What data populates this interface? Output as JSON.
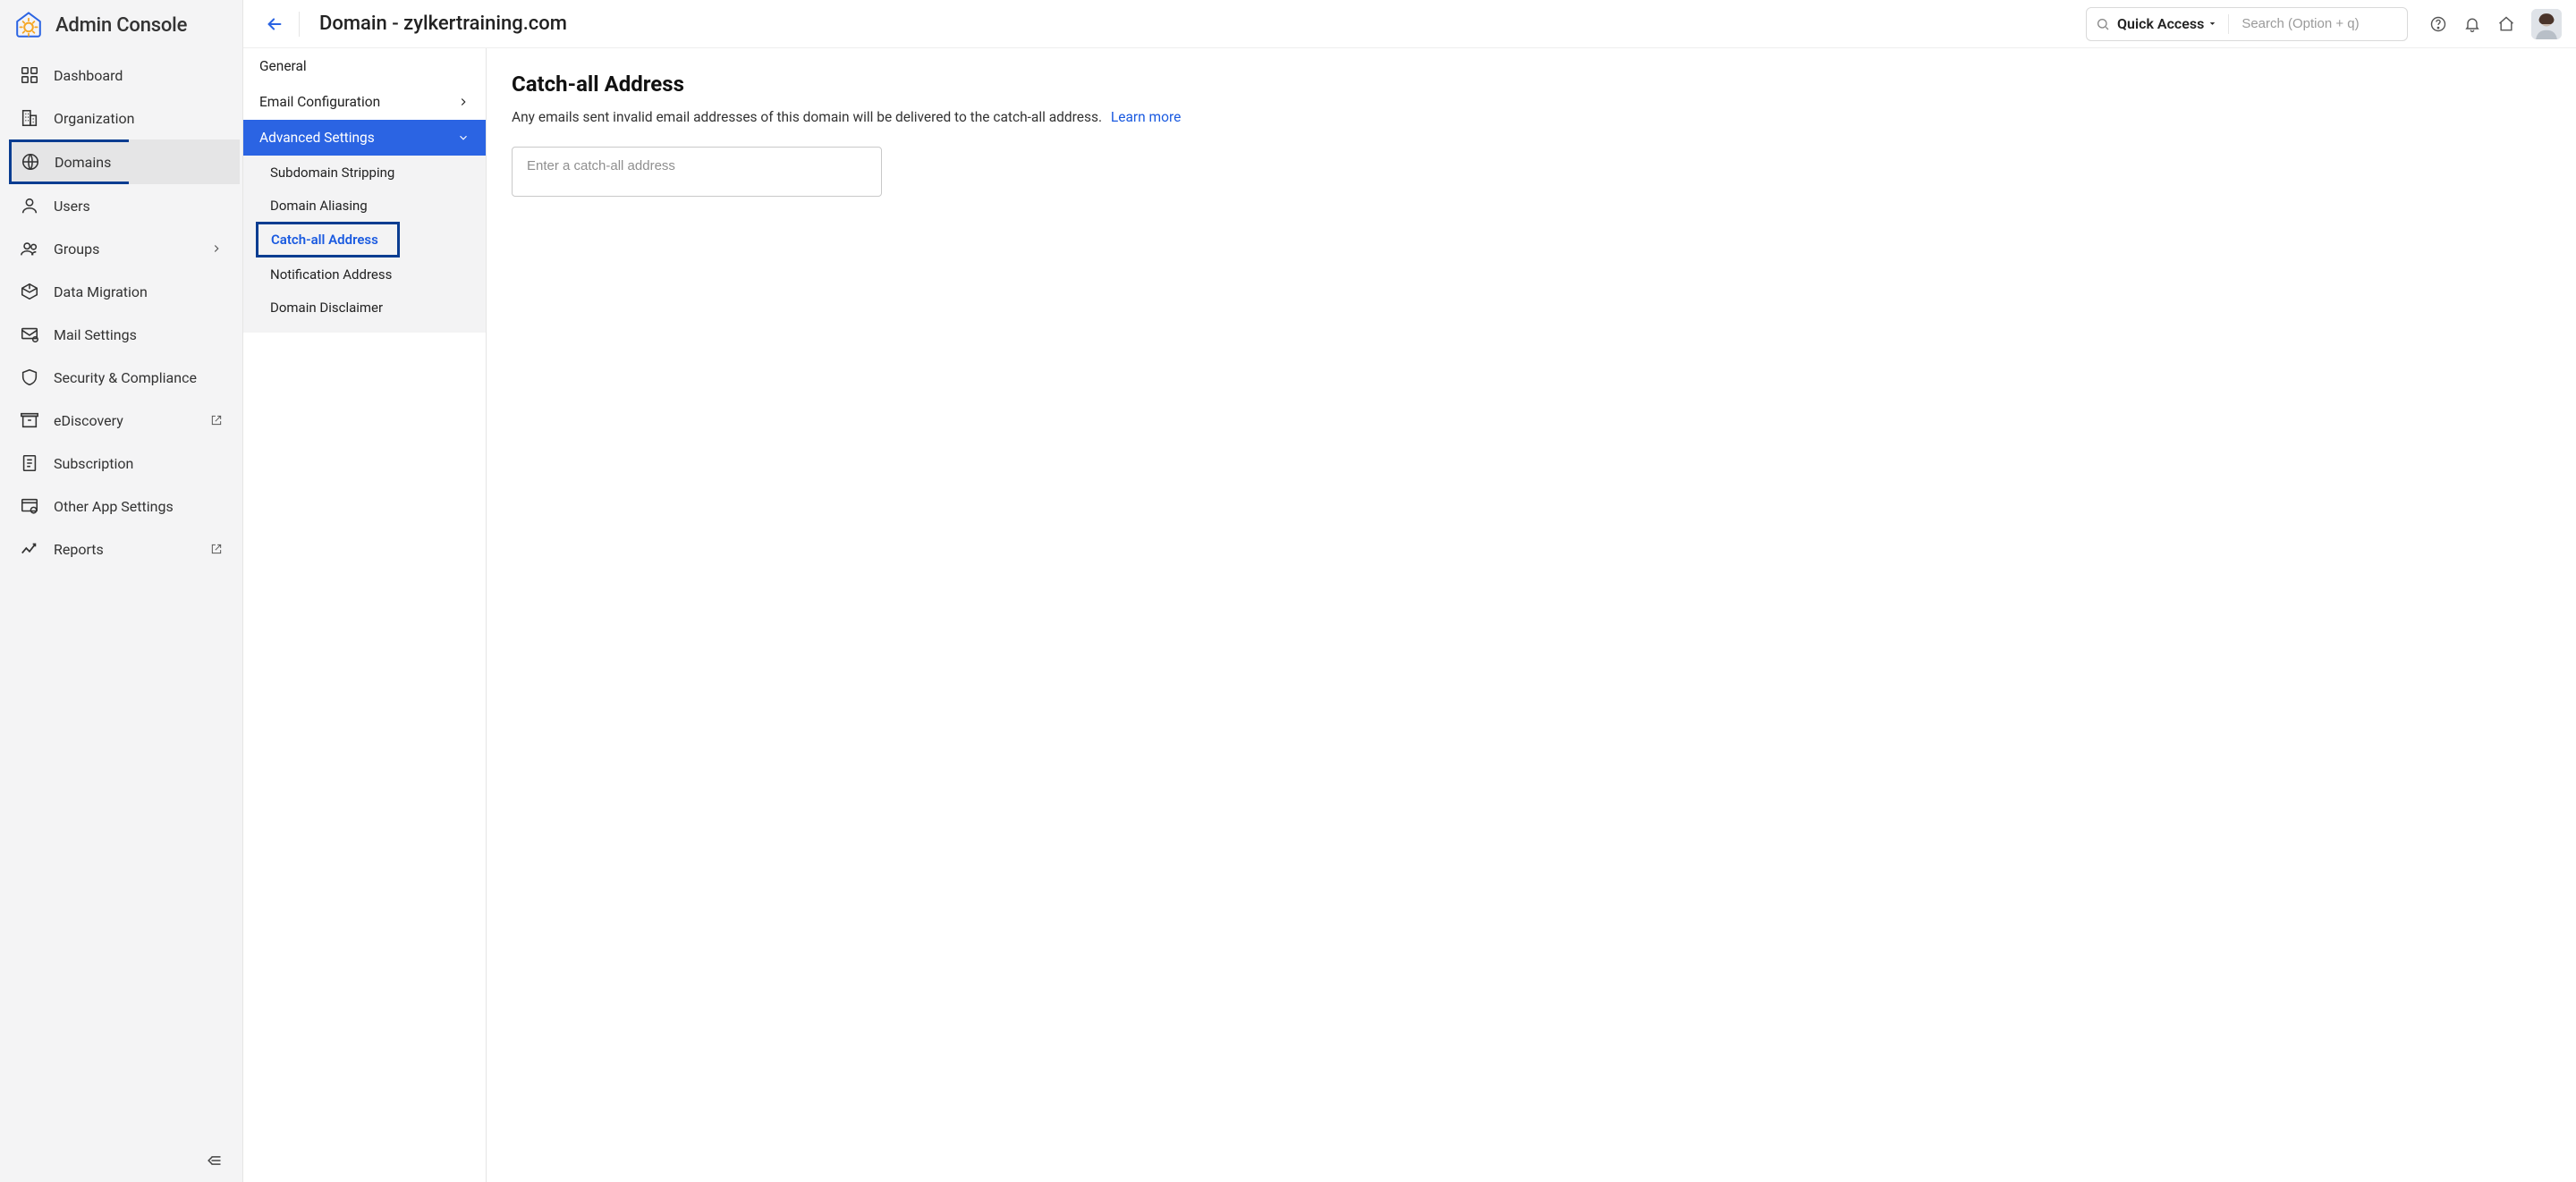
{
  "app": {
    "title": "Admin Console"
  },
  "sidebar": {
    "items": [
      {
        "label": "Dashboard"
      },
      {
        "label": "Organization"
      },
      {
        "label": "Domains"
      },
      {
        "label": "Users"
      },
      {
        "label": "Groups"
      },
      {
        "label": "Data Migration"
      },
      {
        "label": "Mail Settings"
      },
      {
        "label": "Security & Compliance"
      },
      {
        "label": "eDiscovery"
      },
      {
        "label": "Subscription"
      },
      {
        "label": "Other App Settings"
      },
      {
        "label": "Reports"
      }
    ]
  },
  "header": {
    "breadcrumb": "Domain - zylkertraining.com",
    "quick_access_label": "Quick Access",
    "search_placeholder": "Search (Option + q)"
  },
  "subpanel": {
    "items": {
      "general": "General",
      "email_config": "Email Configuration",
      "advanced": "Advanced Settings"
    },
    "advanced_children": [
      "Subdomain Stripping",
      "Domain Aliasing",
      "Catch-all Address",
      "Notification Address",
      "Domain Disclaimer"
    ]
  },
  "main": {
    "heading": "Catch-all Address",
    "description": "Any emails sent invalid email addresses of this domain will be delivered to the catch-all address.",
    "learn_more": "Learn more",
    "input_placeholder": "Enter a catch-all address"
  }
}
